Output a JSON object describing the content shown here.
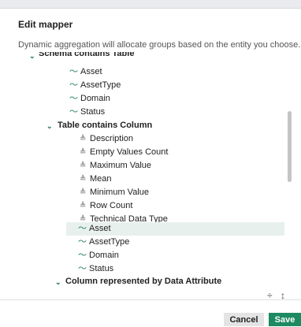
{
  "dialog": {
    "title": "Edit mapper",
    "description": "Dynamic aggregation will allocate groups based on the entity you choose."
  },
  "tree": {
    "group1": {
      "label": "Schema contains Table",
      "items": [
        "Asset",
        "AssetType",
        "Domain",
        "Status"
      ]
    },
    "group2": {
      "label": "Table contains Column",
      "attributes": [
        "Description",
        "Empty Values Count",
        "Maximum Value",
        "Mean",
        "Minimum Value",
        "Row Count",
        "Technical Data Type"
      ],
      "relations": [
        "Asset",
        "AssetType",
        "Domain",
        "Status"
      ]
    },
    "group3": {
      "label": "Column represented by Data Attribute"
    }
  },
  "icons": {
    "relation": "trend-icon",
    "attribute": "attribute-icon",
    "chevron": "chevron-down-icon"
  },
  "controls": {
    "collapse": "÷",
    "resize": "↕"
  },
  "buttons": {
    "cancel": "Cancel",
    "save": "Save"
  },
  "colors": {
    "accent": "#1d8a62",
    "group_text": "#147a5a",
    "highlight": "#e8f0ee"
  }
}
